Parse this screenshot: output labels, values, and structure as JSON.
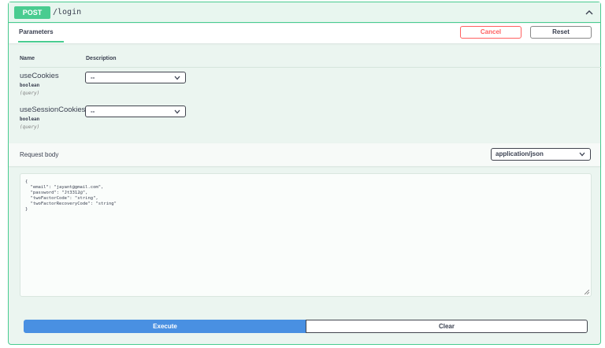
{
  "operation": {
    "method": "POST",
    "path": "/login"
  },
  "parameters_section": {
    "tab_label": "Parameters",
    "cancel_label": "Cancel",
    "reset_label": "Reset",
    "col_name": "Name",
    "col_description": "Description"
  },
  "params": [
    {
      "name": "useCookies",
      "type": "boolean",
      "in": "(query)",
      "selected": "--"
    },
    {
      "name": "useSessionCookies",
      "type": "boolean",
      "in": "(query)",
      "selected": "--"
    }
  ],
  "request_body": {
    "label": "Request body",
    "content_type": "application/json",
    "lines": [
      "{",
      "  \"email\": \"jayant@gmail.com\",",
      "  \"password\": \"Jt3312@\",",
      "  \"twoFactorCode\": \"string\",",
      "  \"twoFactorRecoveryCode\": \"string\"",
      "}"
    ]
  },
  "actions": {
    "execute_label": "Execute",
    "clear_label": "Clear"
  },
  "colors": {
    "post_green": "#49cc90",
    "execute_blue": "#4990e2",
    "cancel_red": "#ff6060"
  }
}
